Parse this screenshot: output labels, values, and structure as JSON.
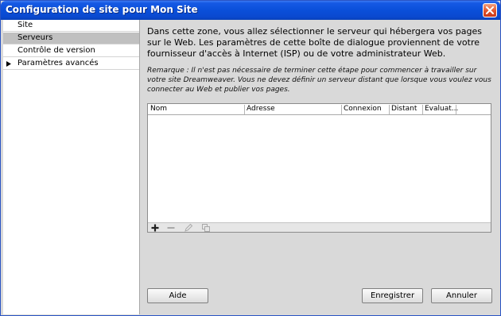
{
  "window": {
    "title": "Configuration de site pour Mon Site"
  },
  "sidebar": {
    "items": [
      {
        "label": "Site",
        "selected": false,
        "has_arrow": false
      },
      {
        "label": "Serveurs",
        "selected": true,
        "has_arrow": false
      },
      {
        "label": "Contrôle de version",
        "selected": false,
        "has_arrow": false
      },
      {
        "label": "Paramètres avancés",
        "selected": false,
        "has_arrow": true
      }
    ]
  },
  "main": {
    "intro": "Dans cette zone, vous allez sélectionner le serveur qui hébergera vos pages sur le Web. Les paramètres de cette boîte de dialogue proviennent de votre fournisseur d'accès à Internet (ISP) ou de votre administrateur Web.",
    "remark": "Remarque : Il n'est pas nécessaire de terminer cette étape pour commencer à travailler sur votre site Dreamweaver. Vous ne devez définir un serveur distant que lorsque vous voulez vous connecter au Web et publier vos pages.",
    "table": {
      "columns": [
        "Nom",
        "Adresse",
        "Connexion",
        "Distant",
        "Evaluat..."
      ],
      "rows": []
    },
    "toolbar": {
      "icons": [
        "add-icon",
        "remove-icon",
        "edit-icon",
        "duplicate-icon"
      ]
    }
  },
  "buttons": {
    "help": "Aide",
    "save": "Enregistrer",
    "cancel": "Annuler"
  }
}
